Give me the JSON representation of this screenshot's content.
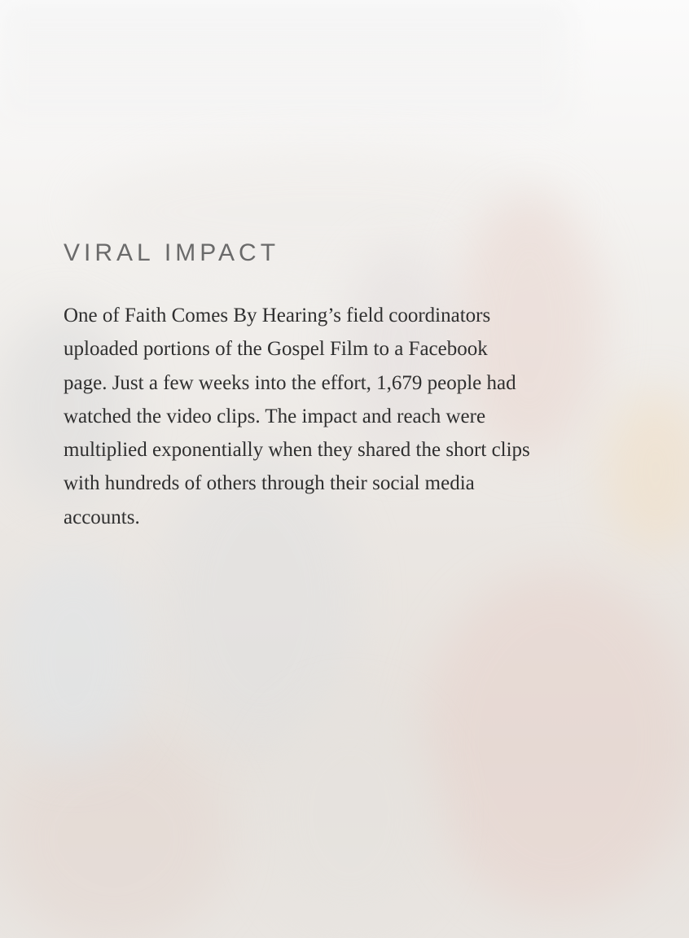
{
  "section": {
    "heading": "VIRAL IMPACT",
    "body": "One of Faith Comes By Hearing’s field coordinators uploaded portions of the Gospel Film to a Facebook page. Just a few weeks into the effort, 1,679 people had watched the video clips. The impact and reach were multiplied exponentially when they shared the short clips with hundreds of others through their social media accounts."
  },
  "colors": {
    "heading": "#6a6a6a",
    "body": "#2f2f2f",
    "background": "#f6f4f2"
  }
}
